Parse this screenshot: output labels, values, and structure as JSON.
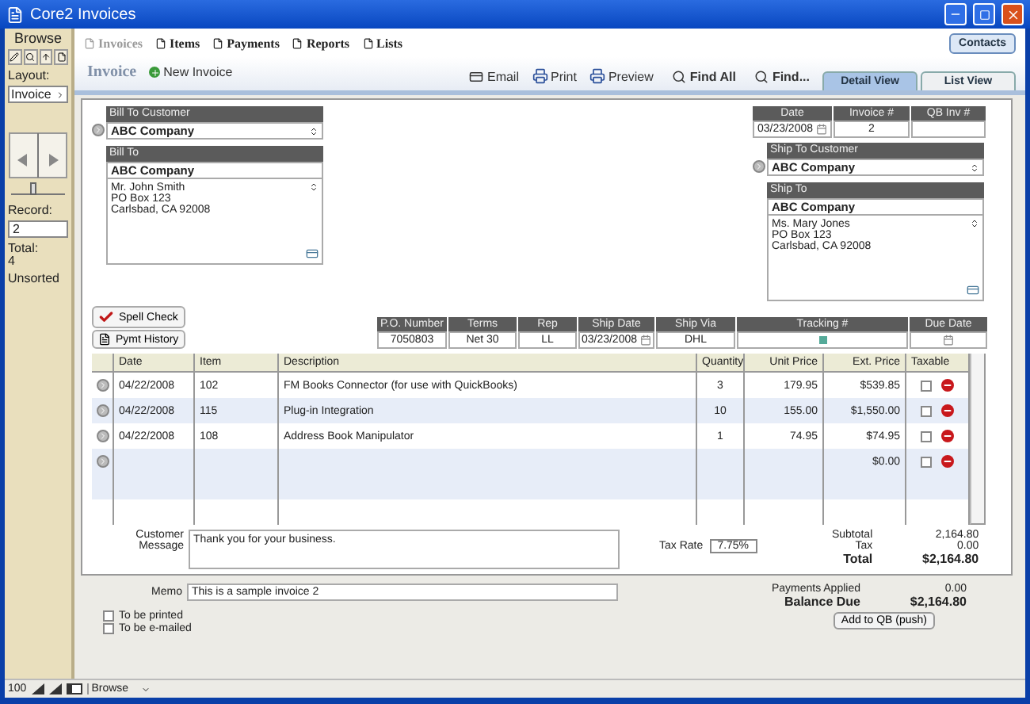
{
  "window": {
    "title": "Core2 Invoices"
  },
  "sidebar": {
    "mode": "Browse",
    "layout_label": "Layout:",
    "layout": "Invoice",
    "record_slider": {
      "level": 0.35
    },
    "record_label": "Record:",
    "record": "2",
    "total_label": "Total:",
    "total": "4",
    "sort_status": "Unsorted"
  },
  "nav_tabs": [
    {
      "label": "Invoices",
      "selected": true
    },
    {
      "label": "Items",
      "selected": false
    },
    {
      "label": "Payments",
      "selected": false
    },
    {
      "label": "Reports",
      "selected": false
    },
    {
      "label": "Lists",
      "selected": false
    }
  ],
  "contacts_button": "Contacts",
  "toolbar": {
    "title": "Invoice",
    "new_button": "New Invoice",
    "actions": [
      {
        "label": "Email",
        "kind": "email"
      },
      {
        "label": "Print",
        "kind": "print"
      },
      {
        "label": "Preview",
        "kind": "print"
      },
      {
        "label": "Find All",
        "kind": "search"
      },
      {
        "label": "Find...",
        "kind": "search"
      }
    ],
    "views": [
      {
        "label": "Detail View",
        "selected": true
      },
      {
        "label": "List View",
        "selected": false
      }
    ]
  },
  "header_fields": [
    {
      "label": "Date",
      "value": "03/23/2008",
      "kind": "date"
    },
    {
      "label": "Invoice #",
      "value": "2",
      "kind": "text"
    },
    {
      "label": "QB Inv #",
      "kind": "text"
    }
  ],
  "bill_to": {
    "customer_label": "Bill To Customer",
    "customer": "ABC Company",
    "address_label": "Bill To",
    "name": "ABC Company",
    "address": [
      "Mr. John Smith",
      "PO Box 123",
      "Carlsbad, CA 92008"
    ]
  },
  "ship_to": {
    "customer_label": "Ship To Customer",
    "customer": "ABC Company",
    "address_label": "Ship To",
    "name": "ABC Company",
    "address": [
      "Ms. Mary Jones",
      "PO Box 123",
      "Carlsbad, CA 92008"
    ]
  },
  "buttons": [
    {
      "label": "Spell Check",
      "kind": "spell"
    },
    {
      "label": "Pymt History",
      "kind": "history"
    }
  ],
  "order_fields": [
    {
      "label": "P.O. Number",
      "value": "7050803",
      "kind": "text"
    },
    {
      "label": "Terms",
      "value": "Net 30",
      "kind": "text"
    },
    {
      "label": "Rep",
      "value": "LL",
      "kind": "text"
    },
    {
      "label": "Ship Date",
      "value": "03/23/2008",
      "kind": "date"
    },
    {
      "label": "Ship Via",
      "value": "DHL",
      "kind": "text"
    },
    {
      "label": "Tracking #",
      "kind": "tracking"
    },
    {
      "label": "Due Date",
      "kind": "date"
    }
  ],
  "table": {
    "columns": [
      "Date",
      "Item",
      "Description",
      "Quantity",
      "Unit Price",
      "Ext. Price",
      "Taxable"
    ],
    "rows": [
      {
        "date": "04/22/2008",
        "item": "102",
        "description": "FM Books Connector (for use with QuickBooks)",
        "quantity": "3",
        "unit_price": "179.95",
        "ext_price": "$539.85",
        "taxable": false
      },
      {
        "date": "04/22/2008",
        "item": "115",
        "description": "Plug-in Integration",
        "quantity": "10",
        "unit_price": "155.00",
        "ext_price": "$1,550.00",
        "taxable": false
      },
      {
        "date": "04/22/2008",
        "item": "108",
        "description": "Address Book Manipulator",
        "quantity": "1",
        "unit_price": "74.95",
        "ext_price": "$74.95",
        "taxable": false
      },
      {
        "ext_price": "$0.00",
        "taxable": false
      }
    ]
  },
  "message": {
    "label": "Customer Message",
    "value": "Thank you for your business."
  },
  "tax_rate": {
    "label": "Tax Rate",
    "value": "7.75%"
  },
  "totals": [
    {
      "label": "Subtotal",
      "value": "2,164.80",
      "bold": false
    },
    {
      "label": "Tax",
      "value": "0.00",
      "bold": false
    },
    {
      "label": "Total",
      "value": "$2,164.80",
      "bold": true
    }
  ],
  "memo": {
    "label": "Memo",
    "value": "This is a sample invoice 2"
  },
  "payments": [
    {
      "label": "Payments Applied",
      "value": "0.00",
      "bold": false
    },
    {
      "label": "Balance Due",
      "value": "$2,164.80",
      "bold": true
    }
  ],
  "flags": [
    {
      "label": "To be printed",
      "checked": false
    },
    {
      "label": "To be e-mailed",
      "checked": false
    }
  ],
  "qb_button": "Add to QB (push)",
  "status_bar": {
    "zoom": "100",
    "mode": "Browse"
  }
}
